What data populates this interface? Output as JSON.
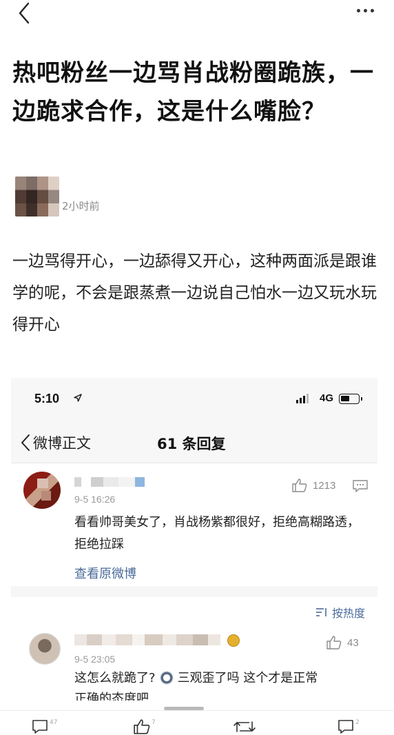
{
  "top_bar": {
    "back_icon": "chevron-left-icon",
    "more_icon": "more-dots-icon"
  },
  "article": {
    "title": "热吧粉丝一边骂肖战粉圈跪族，一边跪求合作，这是什么嘴脸？",
    "time_ago": "2小时前",
    "body": "一边骂得开心，一边舔得又开心，这种两面派是跟谁学的呢，不会是跟蒸煮一边说自己怕水一边又玩水玩得开心"
  },
  "embedded_screenshot": {
    "status_bar": {
      "time": "5:10",
      "network": "4G"
    },
    "nav": {
      "back_label": "微博正文",
      "title": "61 条回复"
    },
    "comments": [
      {
        "time": "9-5 16:26",
        "likes": "1213",
        "text": "看看帅哥美女了，肖战杨紫都很好，拒绝高糊路透，拒绝拉踩",
        "view_original": "查看原微博"
      },
      {
        "time": "9-5 23:05",
        "likes": "43",
        "text_before_emoji": "这怎么就跪了?",
        "text_after_emoji": "三观歪了吗  这个才是正常",
        "text_cut": "正确的态度吧"
      }
    ],
    "sort_label": "按热度"
  },
  "bottom_bar": {
    "comment_count": "47",
    "like_count": "7",
    "share_count": "",
    "reply_count": "2"
  },
  "colors": {
    "link_blue": "#4a6a9a",
    "text_primary": "#1a1a1a",
    "text_muted": "#9a9a9a"
  }
}
